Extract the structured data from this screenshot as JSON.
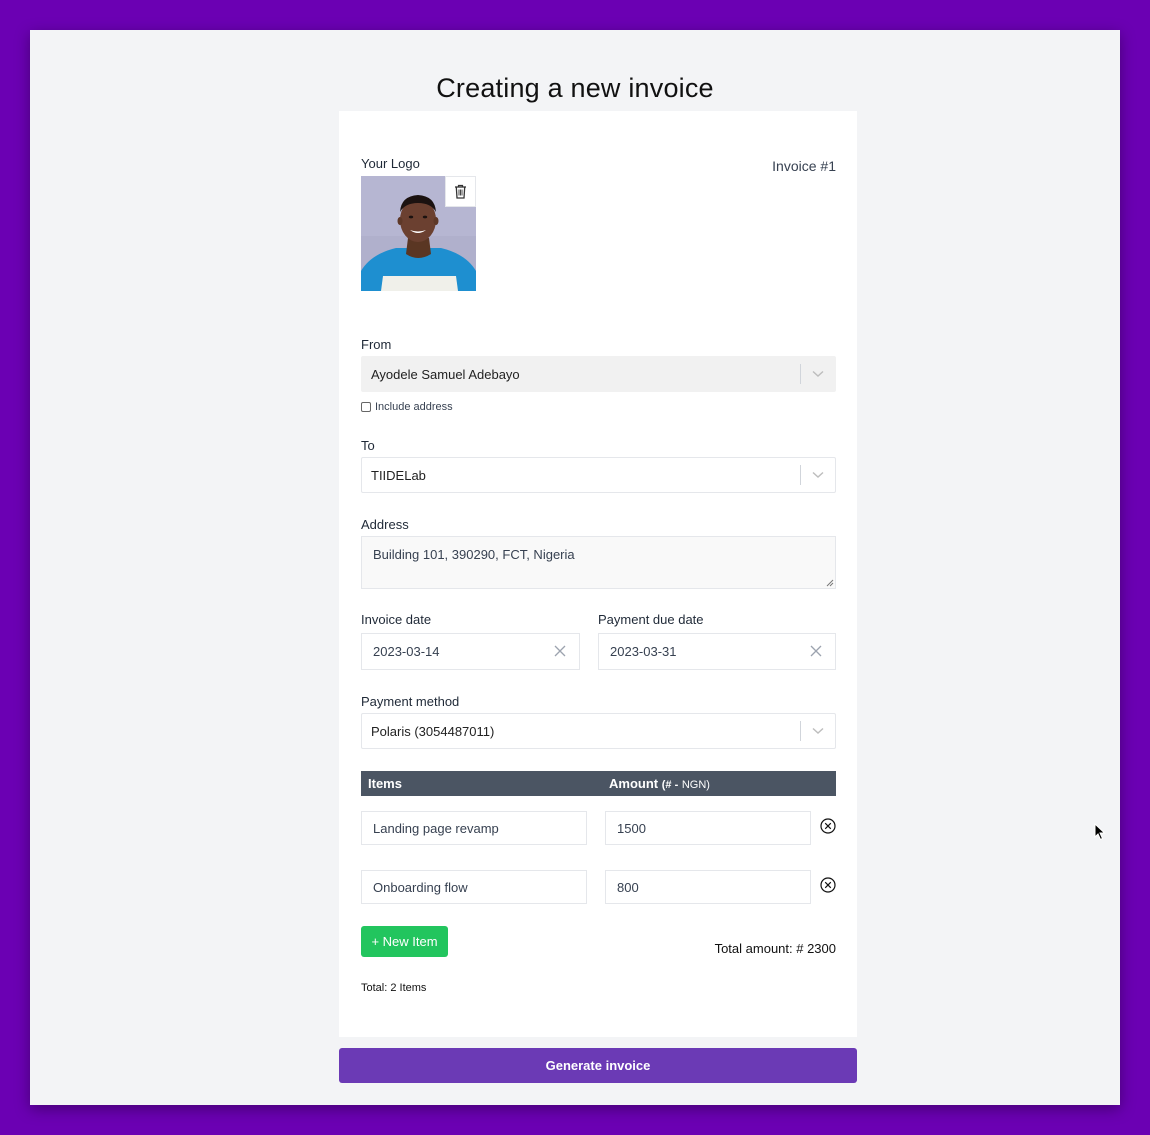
{
  "page": {
    "title": "Creating a new invoice"
  },
  "logo": {
    "label": "Your Logo",
    "delete_icon": "trash-icon"
  },
  "invoice": {
    "number_label": "Invoice #1"
  },
  "from": {
    "label": "From",
    "value": "Ayodele Samuel Adebayo",
    "include_address_label": "Include address",
    "include_address_checked": false
  },
  "to": {
    "label": "To",
    "value": "TIIDELab"
  },
  "address": {
    "label": "Address",
    "value": "Building 101, 390290, FCT, Nigeria"
  },
  "dates": {
    "invoice_date_label": "Invoice date",
    "invoice_date": "2023-03-14",
    "due_date_label": "Payment due date",
    "due_date": "2023-03-31"
  },
  "payment": {
    "label": "Payment method",
    "value": "Polaris (3054487011)"
  },
  "items_table": {
    "col_items": "Items",
    "col_amount": "Amount",
    "col_amount_currency_sym": "(# -",
    "col_amount_currency_code": "NGN)",
    "rows": [
      {
        "name": "Landing page revamp",
        "amount": "1500"
      },
      {
        "name": "Onboarding flow",
        "amount": "800"
      }
    ]
  },
  "actions": {
    "new_item_label": "+ New Item",
    "generate_label": "Generate invoice"
  },
  "totals": {
    "amount": "Total amount: # 2300",
    "items": "Total: 2 Items"
  },
  "colors": {
    "background": "#6b00b3",
    "accent": "#6b3ab5",
    "add_button": "#22c55e",
    "table_header": "#4b5563"
  }
}
